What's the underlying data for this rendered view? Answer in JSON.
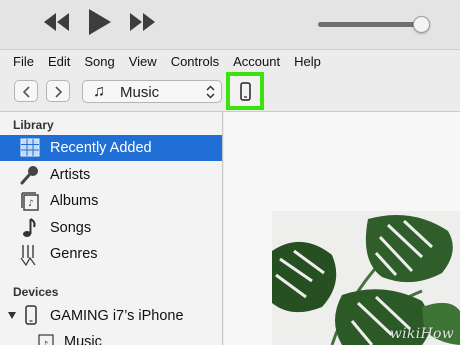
{
  "menu": [
    "File",
    "Edit",
    "Song",
    "View",
    "Controls",
    "Account",
    "Help"
  ],
  "toolbar": {
    "media_kind": "Music",
    "back_icon": "chevron-left-icon",
    "forward_icon": "chevron-right-icon",
    "device_icon": "iphone-icon"
  },
  "player": {
    "volume_level": 0.93
  },
  "sidebar": {
    "library_header": "Library",
    "library_items": [
      {
        "label": "Recently Added",
        "icon": "grid-icon",
        "active": true
      },
      {
        "label": "Artists",
        "icon": "microphone-icon",
        "active": false
      },
      {
        "label": "Albums",
        "icon": "album-icon",
        "active": false
      },
      {
        "label": "Songs",
        "icon": "music-note-icon",
        "active": false
      },
      {
        "label": "Genres",
        "icon": "guitar-icon",
        "active": false
      }
    ],
    "devices_header": "Devices",
    "device_name": "GAMING i7’s iPhone",
    "device_child": "Music"
  },
  "watermark": "wikiHow",
  "colors": {
    "selection": "#1f6fd6",
    "highlight_border": "#3be20c"
  }
}
